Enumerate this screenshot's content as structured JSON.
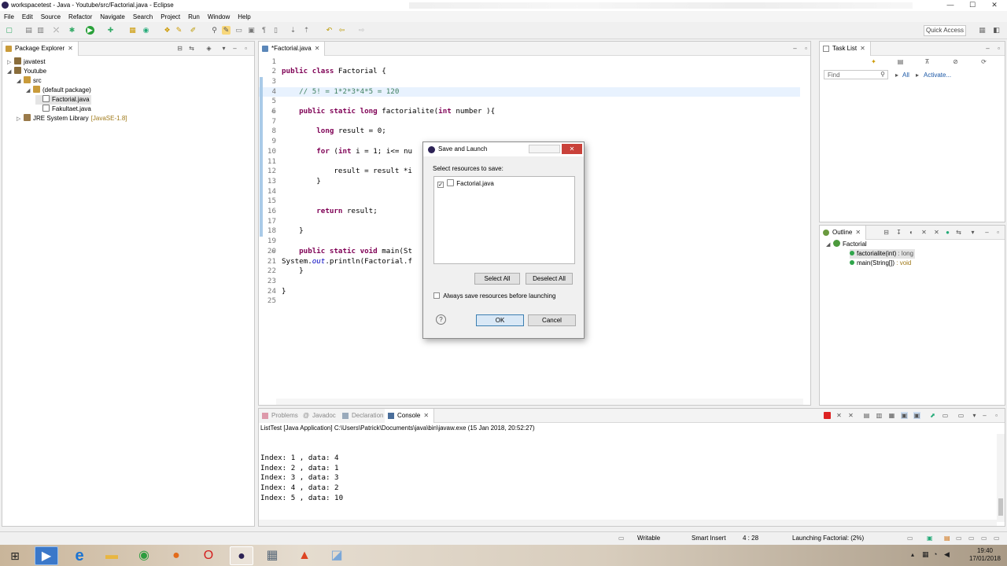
{
  "window": {
    "title": "workspacetest - Java - Youtube/src/Factorial.java - Eclipse"
  },
  "menu": [
    "File",
    "Edit",
    "Source",
    "Refactor",
    "Navigate",
    "Search",
    "Project",
    "Run",
    "Window",
    "Help"
  ],
  "toolbar": {
    "quick_access": "Quick Access"
  },
  "package_explorer": {
    "title": "Package Explorer",
    "tree": [
      {
        "label": "javatest",
        "level": 0,
        "expanded": false,
        "icon": "project-icon"
      },
      {
        "label": "Youtube",
        "level": 0,
        "expanded": true,
        "icon": "project-icon"
      },
      {
        "label": "src",
        "level": 1,
        "expanded": true,
        "icon": "source-folder-icon"
      },
      {
        "label": "(default package)",
        "level": 2,
        "expanded": true,
        "icon": "package-icon"
      },
      {
        "label": "Factorial.java",
        "level": 3,
        "expanded": false,
        "icon": "java-file-icon",
        "selected": true
      },
      {
        "label": "Fakultaet.java",
        "level": 3,
        "expanded": false,
        "icon": "java-file-icon"
      },
      {
        "label": "JRE System Library",
        "suffix": "[JavaSE-1.8]",
        "level": 1,
        "expanded": false,
        "icon": "library-icon"
      }
    ]
  },
  "editor": {
    "tab": "*Factorial.java",
    "lines": [
      {
        "n": "1",
        "html": ""
      },
      {
        "n": "2",
        "html": "<span class='kw'>public class</span> Factorial {"
      },
      {
        "n": "3",
        "html": ""
      },
      {
        "n": "4",
        "html": "    <span class='cm'>// 5! = 1*2*3*4*5 = 120</span>"
      },
      {
        "n": "5",
        "html": ""
      },
      {
        "n": "6",
        "html": "    <span class='kw'>public static long</span> factorialite(<span class='kw'>int</span> number ){"
      },
      {
        "n": "7",
        "html": ""
      },
      {
        "n": "8",
        "html": "        <span class='kw'>long</span> result = 0;"
      },
      {
        "n": "9",
        "html": ""
      },
      {
        "n": "10",
        "html": "        <span class='kw'>for</span> (<span class='kw'>int</span> i = 1; i&lt;= nu"
      },
      {
        "n": "11",
        "html": ""
      },
      {
        "n": "12",
        "html": "            result = result *i"
      },
      {
        "n": "13",
        "html": "        }"
      },
      {
        "n": "14",
        "html": ""
      },
      {
        "n": "15",
        "html": ""
      },
      {
        "n": "16",
        "html": "        <span class='kw'>return</span> result;"
      },
      {
        "n": "17",
        "html": ""
      },
      {
        "n": "18",
        "html": "    }"
      },
      {
        "n": "19",
        "html": ""
      },
      {
        "n": "20",
        "html": "    <span class='kw'>public static void</span> main(St"
      },
      {
        "n": "21",
        "html": "System.<i style='color:#0000c0'>out</i>.println(Factorial.f"
      },
      {
        "n": "22",
        "html": "    }"
      },
      {
        "n": "23",
        "html": ""
      },
      {
        "n": "24",
        "html": "}"
      },
      {
        "n": "25",
        "html": ""
      }
    ]
  },
  "task_list": {
    "title": "Task List",
    "find_placeholder": "Find",
    "all_label": "All",
    "activate_label": "Activate..."
  },
  "outline": {
    "title": "Outline",
    "root": "Factorial",
    "members": [
      {
        "name": "factorialite(int)",
        "type": ": long",
        "selected": true
      },
      {
        "name": "main(String[])",
        "type": ": void",
        "selected": false
      }
    ]
  },
  "bottom_tabs": [
    "Problems",
    "Javadoc",
    "Declaration",
    "Console"
  ],
  "console": {
    "header": "ListTest [Java Application] C:\\Users\\Patrick\\Documents\\java\\bin\\javaw.exe (15 Jan 2018, 20:52:27)",
    "lines": [
      "Index: 1 , data: 4",
      "Index: 2 , data: 1",
      "Index: 3 , data: 3",
      "Index: 4 , data: 2",
      "Index: 5 , data: 10"
    ]
  },
  "dialog": {
    "title": "Save and Launch",
    "prompt": "Select resources to save:",
    "resources": [
      {
        "label": "Factorial.java",
        "checked": true
      }
    ],
    "select_all": "Select All",
    "deselect_all": "Deselect All",
    "always_save": "Always save resources before launching",
    "ok": "OK",
    "cancel": "Cancel"
  },
  "status": {
    "writable": "Writable",
    "insert_mode": "Smart Insert",
    "position": "4 : 28",
    "progress": "Launching Factorial: (2%)"
  },
  "clock": {
    "time": "19:40",
    "date": "17/01/2018"
  },
  "colors": {
    "accent": "#3c7fb1",
    "keyword": "#7f0055",
    "comment": "#3f7f5f",
    "eclipse": "#2c2255"
  }
}
